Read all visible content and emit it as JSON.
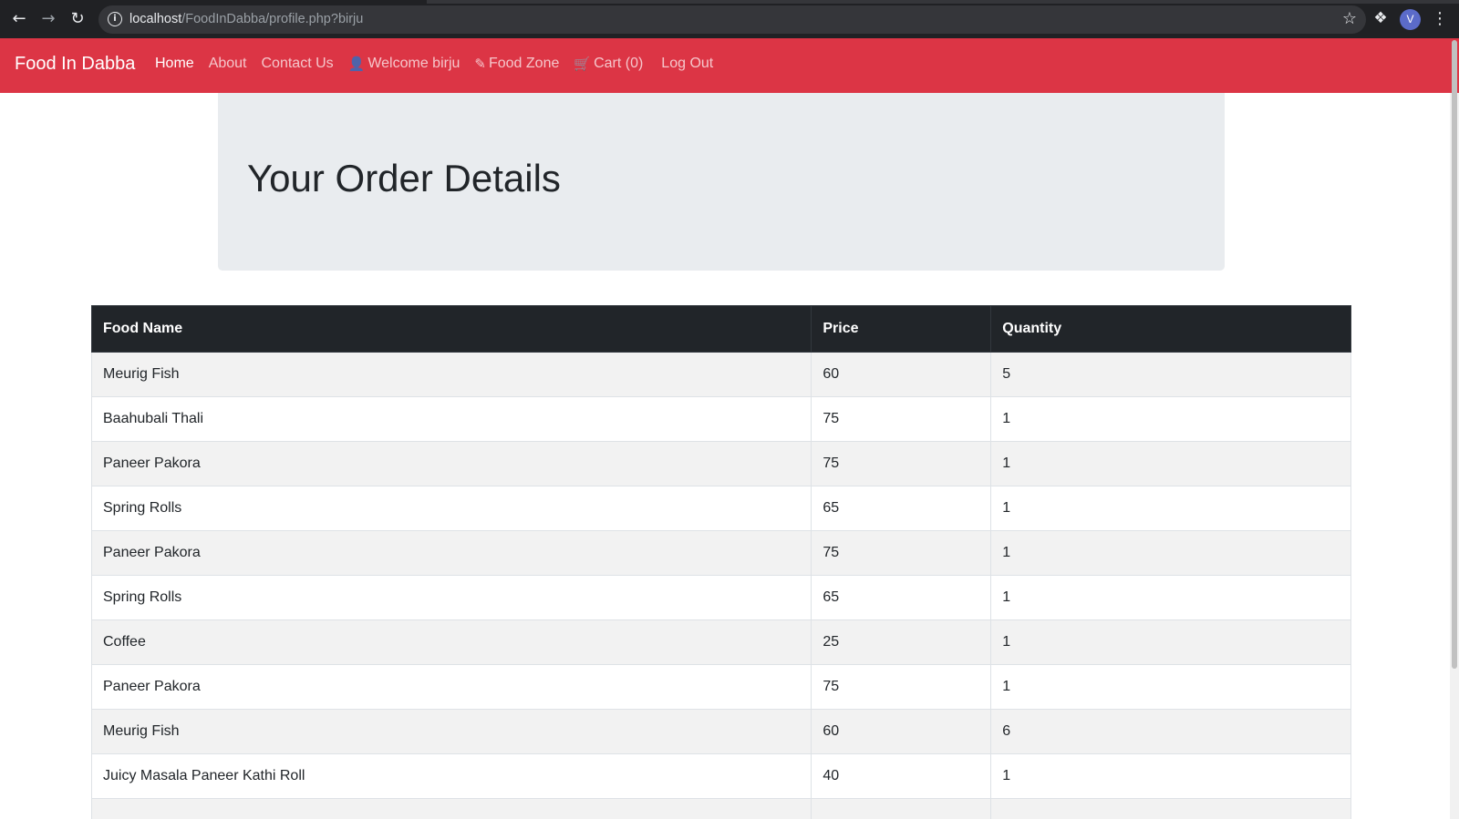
{
  "browser": {
    "url_host": "localhost",
    "url_path": "/FoodInDabba/profile.php?birju",
    "profile_initial": "V",
    "icons": [
      "back-icon",
      "forward-icon",
      "reload-icon",
      "info-icon",
      "star-icon",
      "extensions-icon",
      "menu-icon"
    ]
  },
  "navbar": {
    "brand": "Food In Dabba",
    "links": [
      {
        "label": "Home",
        "icon": null,
        "active": true
      },
      {
        "label": "About",
        "icon": null,
        "active": false
      },
      {
        "label": "Contact Us",
        "icon": null,
        "active": false
      },
      {
        "label": "Welcome birju",
        "icon": "user-icon",
        "active": false
      },
      {
        "label": "Food Zone",
        "icon": "pencil-icon",
        "active": false
      },
      {
        "label": "Cart (0)",
        "icon": "cart-icon",
        "active": false
      },
      {
        "label": "Log Out",
        "icon": null,
        "active": false
      }
    ],
    "color": "#dc3545"
  },
  "jumbotron": {
    "title": "Your Order Details"
  },
  "orders": {
    "headers": [
      "Food Name",
      "Price",
      "Quantity"
    ],
    "rows": [
      [
        "Meurig Fish",
        "60",
        "5"
      ],
      [
        "Baahubali Thali",
        "75",
        "1"
      ],
      [
        "Paneer Pakora",
        "75",
        "1"
      ],
      [
        "Spring Rolls",
        "65",
        "1"
      ],
      [
        "Paneer Pakora",
        "75",
        "1"
      ],
      [
        "Spring Rolls",
        "65",
        "1"
      ],
      [
        "Coffee",
        "25",
        "1"
      ],
      [
        "Paneer Pakora",
        "75",
        "1"
      ],
      [
        "Meurig Fish",
        "60",
        "6"
      ],
      [
        "Juicy Masala Paneer Kathi Roll",
        "40",
        "1"
      ],
      [
        "",
        "",
        ""
      ]
    ]
  }
}
